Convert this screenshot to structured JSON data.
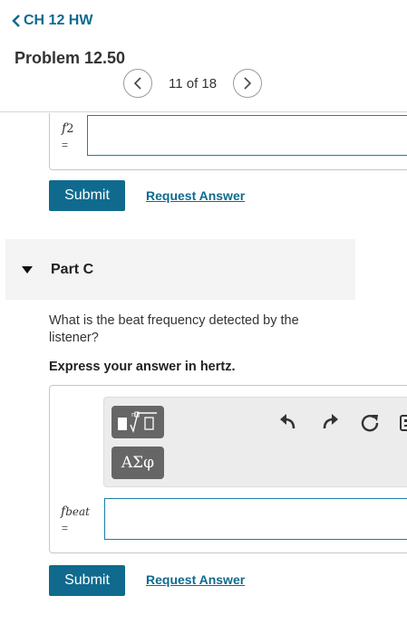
{
  "header": {
    "back_label": "CH 12 HW",
    "problem_title": "Problem 12.50",
    "pager_text": "11 of 18"
  },
  "part_b": {
    "var_main": "f",
    "var_sub": "2",
    "equals": "=",
    "input_value": "",
    "submit_label": "Submit",
    "request_label": "Request Answer"
  },
  "part_c": {
    "title": "Part C",
    "question": "What is the beat frequency detected by the listener?",
    "instruction": "Express your answer in hertz.",
    "var_main": "f",
    "var_sub": "beat",
    "equals": "=",
    "input_value": "",
    "greek_label": "ΑΣφ",
    "submit_label": "Submit",
    "request_label": "Request Answer"
  },
  "colors": {
    "accent": "#0f6a8e",
    "toolbar_bg": "#ececec",
    "part_header_bg": "#f4f4f4"
  },
  "icons": [
    "chevron-left-icon",
    "chevron-right-icon",
    "triangle-down-icon",
    "templates-icon",
    "undo-icon",
    "redo-icon",
    "reset-icon",
    "keyboard-icon"
  ]
}
